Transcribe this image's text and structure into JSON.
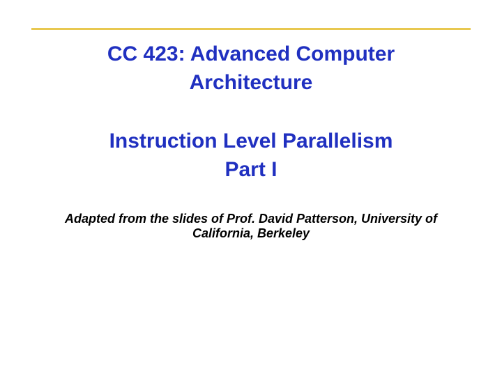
{
  "title": {
    "line1": "CC 423: Advanced Computer",
    "line2": "Architecture"
  },
  "subtitle": {
    "line1": "Instruction Level Parallelism",
    "line2": "Part I"
  },
  "attribution": {
    "line1": "Adapted from the slides of Prof. David Patterson, University of",
    "line2": "California, Berkeley"
  }
}
